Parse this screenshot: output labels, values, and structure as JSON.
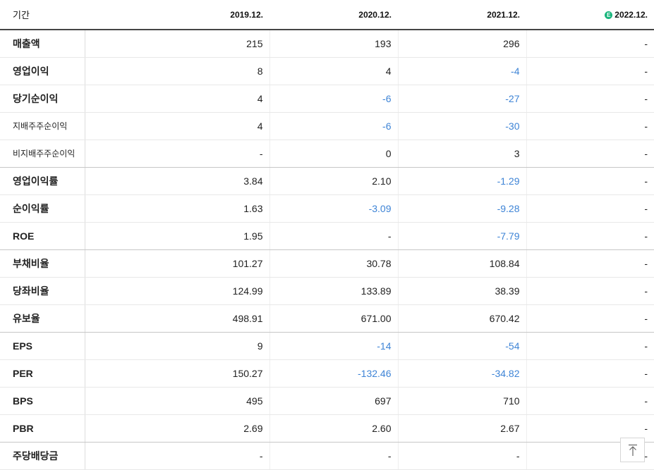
{
  "header": {
    "label": "기간",
    "periods": [
      "2019.12.",
      "2020.12.",
      "2021.12.",
      "2022.12."
    ],
    "estimate_badge": "E"
  },
  "colors": {
    "negative": "#3e84d6",
    "estimate_badge": "#19b57c",
    "text": "#222222"
  },
  "rows": [
    {
      "label": "매출액",
      "values": [
        "215",
        "193",
        "296",
        "-"
      ]
    },
    {
      "label": "영업이익",
      "values": [
        "8",
        "4",
        "-4",
        "-"
      ]
    },
    {
      "label": "당기순이익",
      "values": [
        "4",
        "-6",
        "-27",
        "-"
      ]
    },
    {
      "label": "지배주주순이익",
      "values": [
        "4",
        "-6",
        "-30",
        "-"
      ]
    },
    {
      "label": "비지배주주순이익",
      "values": [
        "-",
        "0",
        "3",
        "-"
      ]
    },
    {
      "label": "영업이익률",
      "values": [
        "3.84",
        "2.10",
        "-1.29",
        "-"
      ]
    },
    {
      "label": "순이익률",
      "values": [
        "1.63",
        "-3.09",
        "-9.28",
        "-"
      ]
    },
    {
      "label": "ROE",
      "values": [
        "1.95",
        "-",
        "-7.79",
        "-"
      ]
    },
    {
      "label": "부채비율",
      "values": [
        "101.27",
        "30.78",
        "108.84",
        "-"
      ]
    },
    {
      "label": "당좌비율",
      "values": [
        "124.99",
        "133.89",
        "38.39",
        "-"
      ]
    },
    {
      "label": "유보율",
      "values": [
        "498.91",
        "671.00",
        "670.42",
        "-"
      ]
    },
    {
      "label": "EPS",
      "values": [
        "9",
        "-14",
        "-54",
        "-"
      ]
    },
    {
      "label": "PER",
      "values": [
        "150.27",
        "-132.46",
        "-34.82",
        "-"
      ]
    },
    {
      "label": "BPS",
      "values": [
        "495",
        "697",
        "710",
        "-"
      ]
    },
    {
      "label": "PBR",
      "values": [
        "2.69",
        "2.60",
        "2.67",
        "-"
      ]
    },
    {
      "label": "주당배당금",
      "values": [
        "-",
        "-",
        "-",
        "-"
      ]
    }
  ],
  "scroll_top_icon": "arrow-up-to-top-icon"
}
